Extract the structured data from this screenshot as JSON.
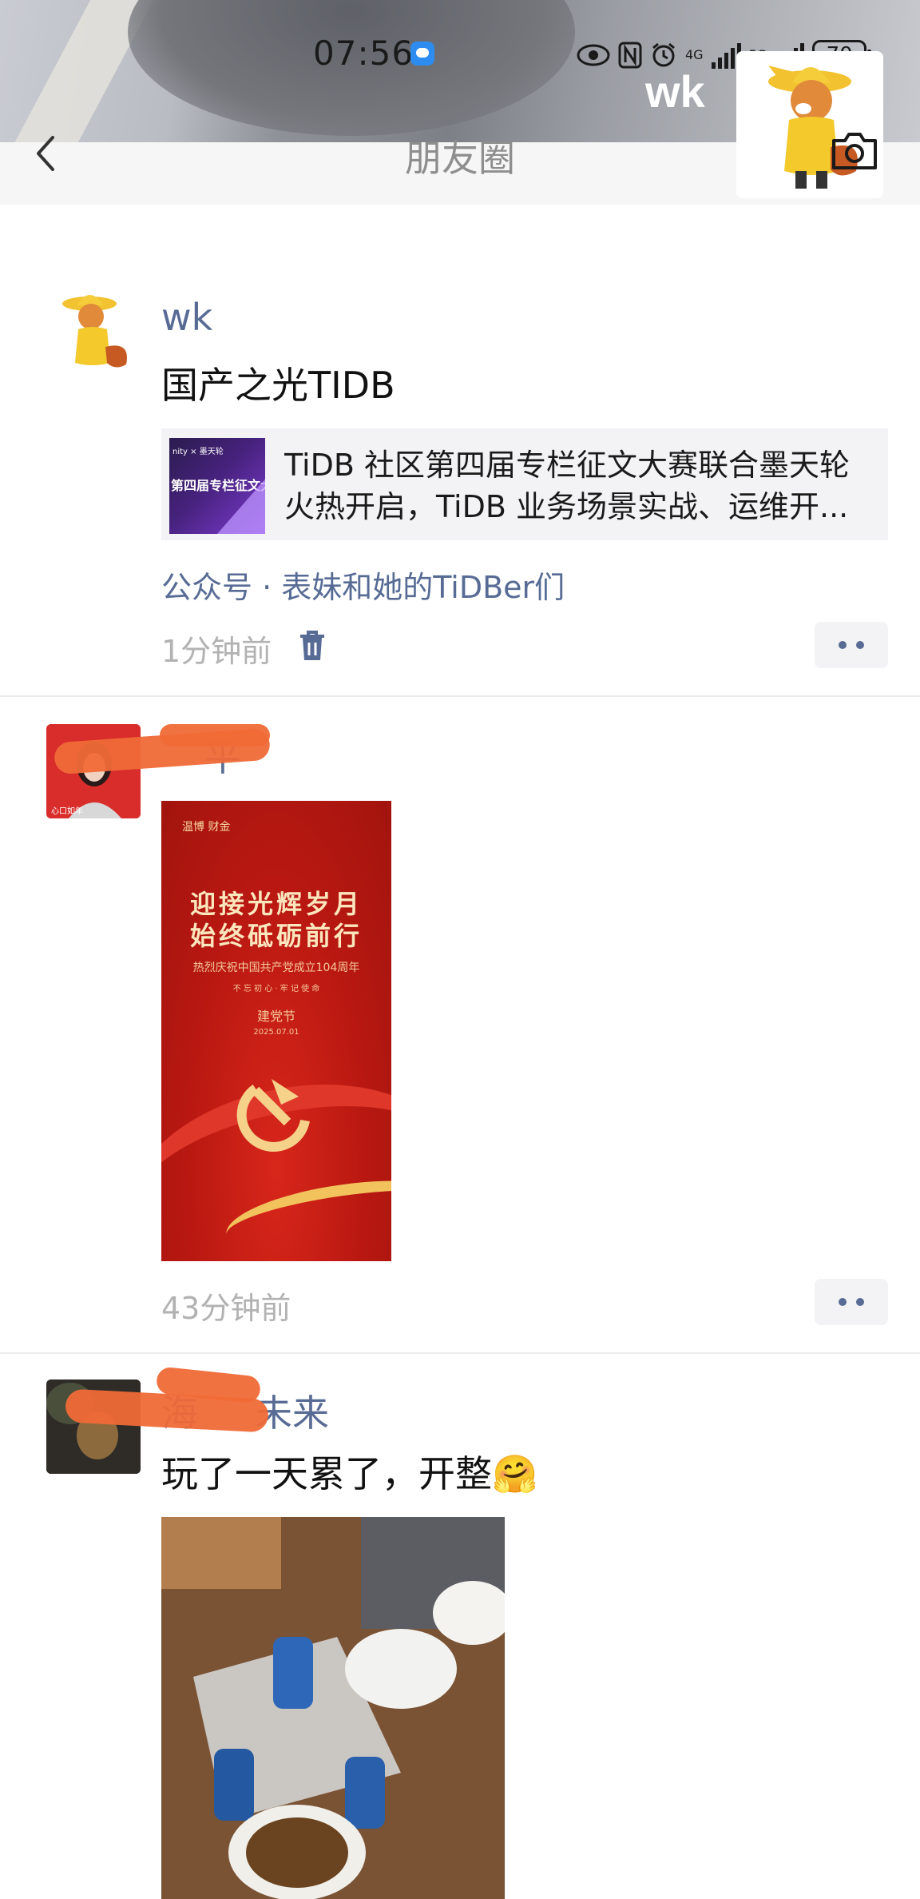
{
  "status_bar": {
    "time": "07:56",
    "net_4g": "4G",
    "net_5g": "5G",
    "battery": "70"
  },
  "header": {
    "title": "朋友圈",
    "cover_name": "wk"
  },
  "posts": [
    {
      "author": "wk",
      "text": "国产之光TIDB",
      "link": {
        "thumb_top": "nity × 墨天轮",
        "thumb_title": "第四届专栏征文大",
        "line1": "TiDB 社区第四届专栏征文大赛联合墨天轮",
        "line2": "火热开启，TiDB 业务场景实战、运维开..."
      },
      "source": "公众号 · 表妹和她的TiDBer们",
      "time": "1分钟前"
    },
    {
      "author": "平",
      "poster": {
        "logo": "温博 财金",
        "line1": "迎接光辉岁月",
        "line2": "始终砥砺前行",
        "sub": "热烈庆祝中国共产党成立104周年",
        "sub2": "不 忘 初 心 · 牢 记 使 命",
        "tag": "建党节",
        "date": "2025.07.01"
      },
      "avatar_caption": "心口如年",
      "time": "43分钟前"
    },
    {
      "author": "未来",
      "author_prefix": "海",
      "text": "玩了一天累了，开整🤗"
    }
  ]
}
